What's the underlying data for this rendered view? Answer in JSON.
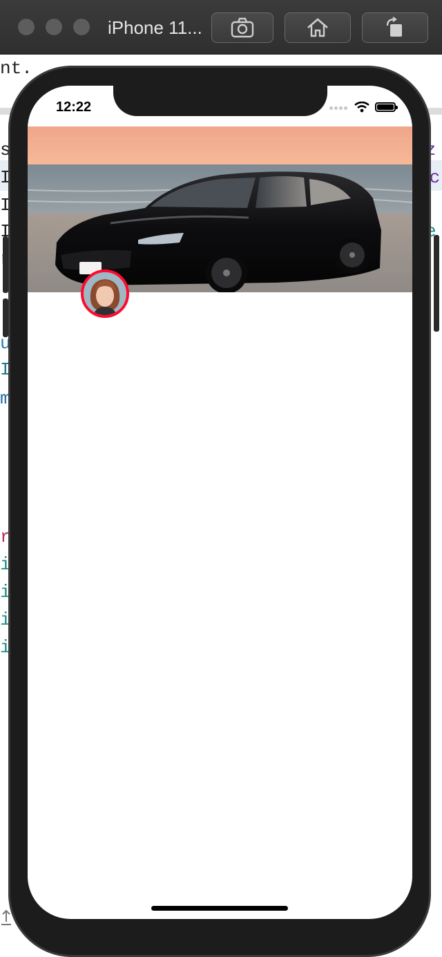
{
  "simulator": {
    "title": "iPhone 11...",
    "buttons": [
      "screenshot",
      "home",
      "rotate"
    ]
  },
  "status_bar": {
    "time": "12:22"
  },
  "profile": {
    "cover_alt": "Black sedan parked by the sea at sunset",
    "avatar_alt": "Profile photo",
    "avatar_border_color": "#ff0a2e"
  },
  "ide_background": {
    "fragments": [
      "nt.",
      "s",
      "I",
      "I",
      "I",
      "r",
      "u",
      "I",
      "m",
      "r",
      "i",
      "i",
      "i",
      "i",
      ".z",
      "ac",
      "e"
    ]
  },
  "colors": {
    "titlebar": "#333333",
    "phone_bezel": "#1c1c1c",
    "avatar_border": "#ff0a2e"
  }
}
